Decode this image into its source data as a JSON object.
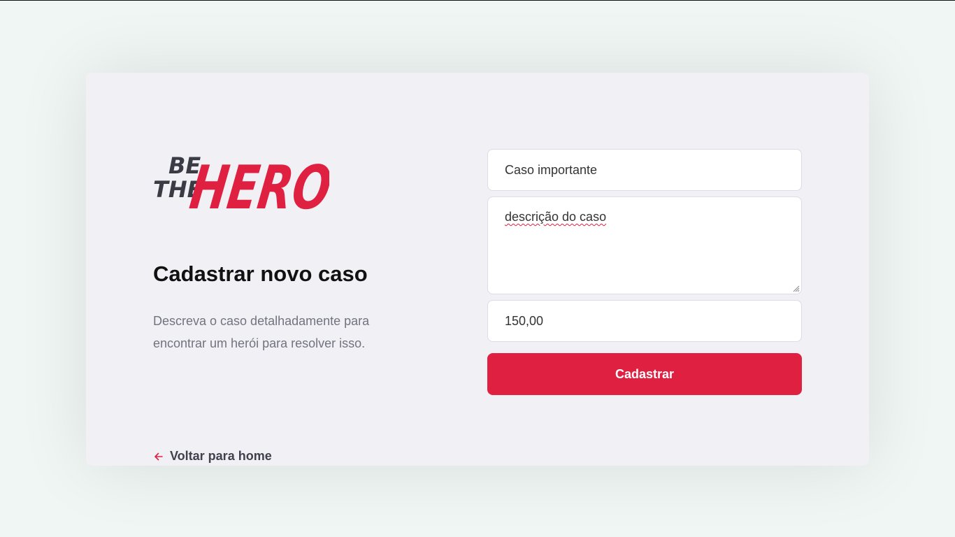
{
  "logo": {
    "line1": "BE",
    "line2": "THE",
    "hero": "HERO"
  },
  "heading": "Cadastrar novo caso",
  "description": "Descreva o caso detalhadamente para encontrar um herói para resolver isso.",
  "back_link": {
    "label": "Voltar para home",
    "icon": "arrow-left-icon"
  },
  "form": {
    "title_value": "Caso importante",
    "description_value": "descrição do caso",
    "amount_value": "150,00",
    "submit_label": "Cadastrar"
  },
  "colors": {
    "accent": "#e02041",
    "card_bg": "#f0f0f5",
    "page_bg": "#f0f6f4",
    "text_muted": "#737380",
    "text_dark": "#41414d"
  }
}
